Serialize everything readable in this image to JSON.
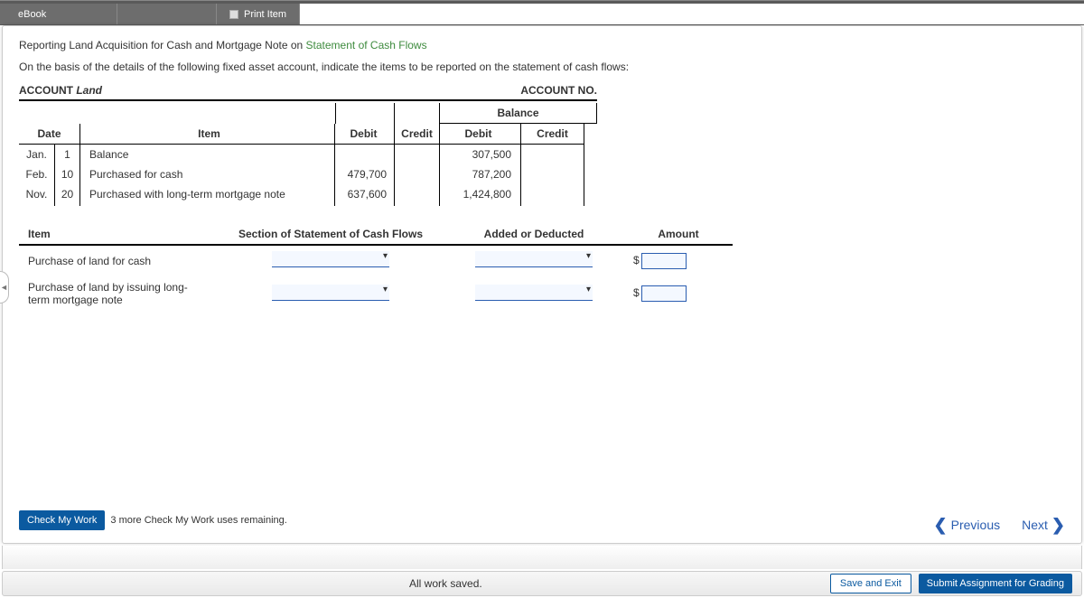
{
  "tabs": {
    "ebook": "eBook",
    "print": "Print Item"
  },
  "title": {
    "prefix": "Reporting Land Acquisition for Cash and Mortgage Note on ",
    "link": "Statement of Cash Flows"
  },
  "instruction": "On the basis of the details of the following fixed asset account, indicate the items to be reported on the statement of cash flows:",
  "account": {
    "label": "ACCOUNT",
    "name": "Land",
    "no_label": "ACCOUNT NO."
  },
  "ledger": {
    "headers": {
      "date": "Date",
      "item": "Item",
      "debit": "Debit",
      "credit": "Credit",
      "balance": "Balance",
      "bdebit": "Debit",
      "bcredit": "Credit"
    },
    "rows": [
      {
        "month": "Jan.",
        "day": "1",
        "item": "Balance",
        "debit": "",
        "credit": "",
        "bdebit": "307,500",
        "bcredit": ""
      },
      {
        "month": "Feb.",
        "day": "10",
        "item": "Purchased for cash",
        "debit": "479,700",
        "credit": "",
        "bdebit": "787,200",
        "bcredit": ""
      },
      {
        "month": "Nov.",
        "day": "20",
        "item": "Purchased with long-term mortgage note",
        "debit": "637,600",
        "credit": "",
        "bdebit": "1,424,800",
        "bcredit": ""
      }
    ]
  },
  "answers": {
    "headers": {
      "item": "Item",
      "section": "Section of Statement of Cash Flows",
      "added": "Added or Deducted",
      "amount": "Amount"
    },
    "rows": [
      {
        "item": "Purchase of land for cash",
        "currency": "$"
      },
      {
        "item": "Purchase of land by issuing long-term mortgage note",
        "currency": "$"
      }
    ]
  },
  "check": {
    "button": "Check My Work",
    "hint": "3 more Check My Work uses remaining."
  },
  "nav": {
    "prev": "Previous",
    "next": "Next"
  },
  "footer": {
    "status": "All work saved.",
    "save": "Save and Exit",
    "submit": "Submit Assignment for Grading"
  }
}
